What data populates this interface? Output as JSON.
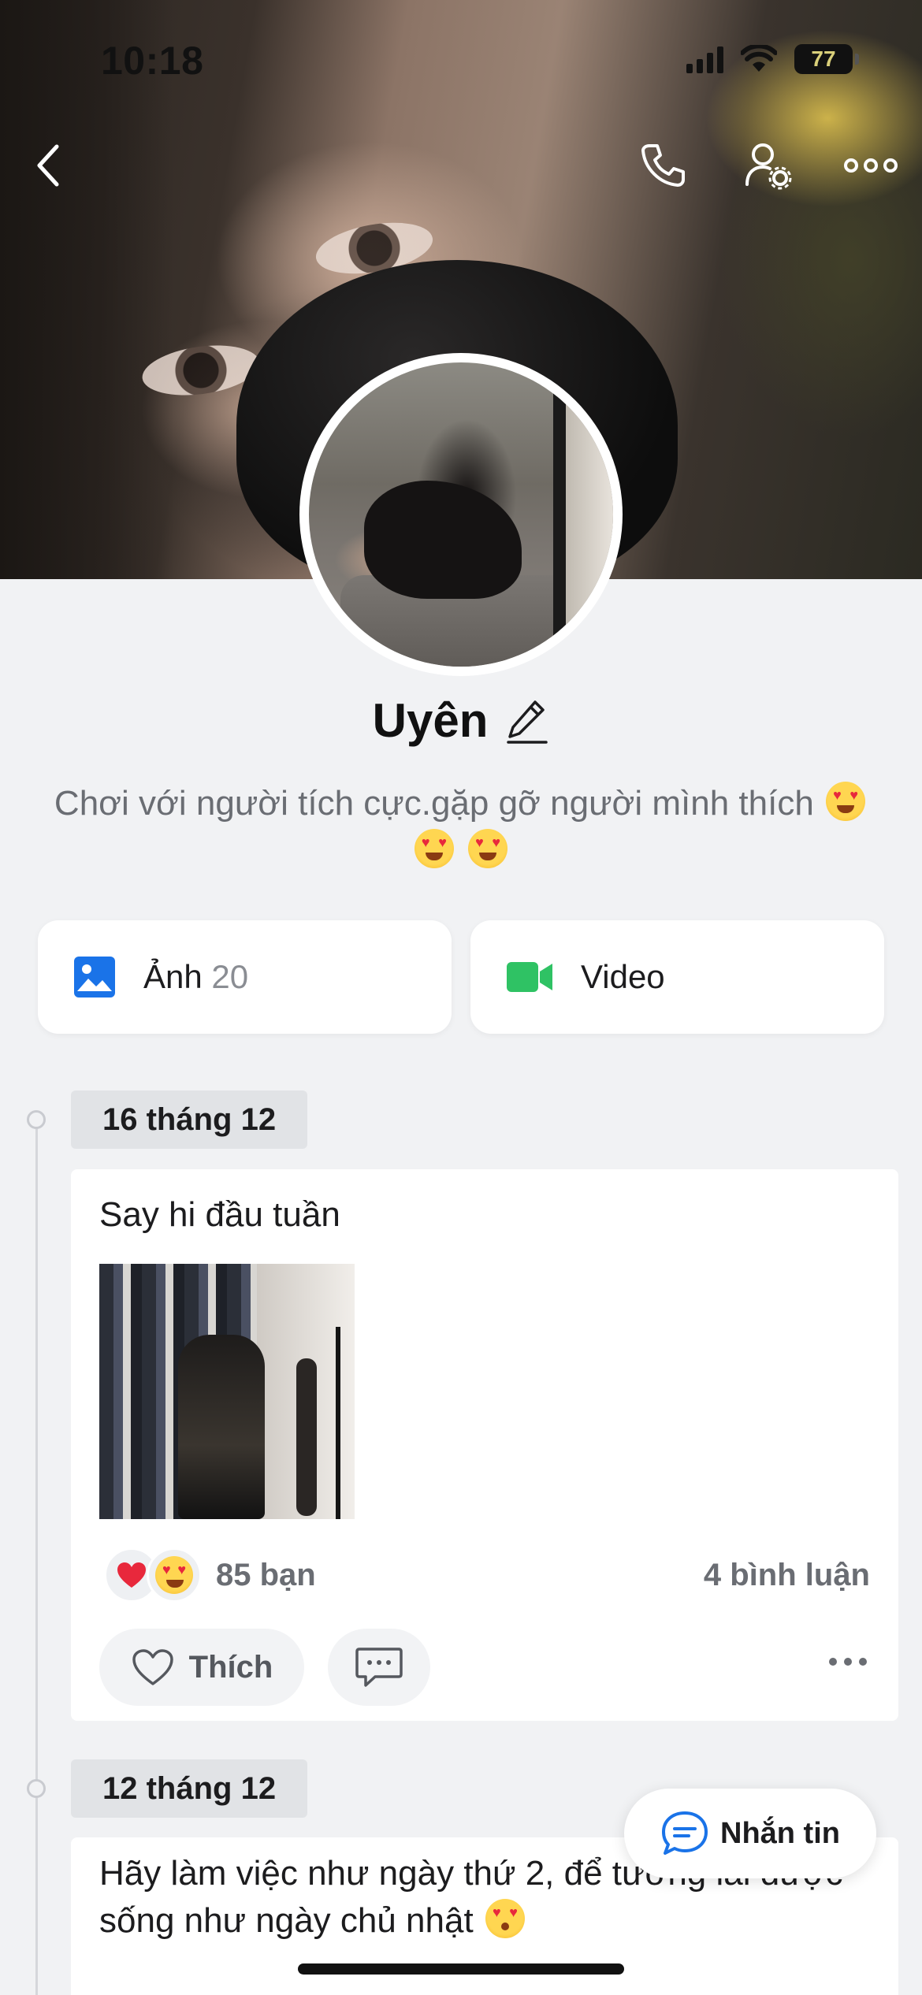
{
  "status_bar": {
    "time": "10:18",
    "battery": "77"
  },
  "profile": {
    "name": "Uyên",
    "bio_line1": "Chơi với người tích cực.gặp gỡ người mình thích",
    "bio_emojis": [
      "heart-eyes",
      "heart-eyes",
      "heart-eyes"
    ]
  },
  "media": {
    "photos_label": "Ảnh",
    "photos_count": "20",
    "video_label": "Video"
  },
  "posts": [
    {
      "date": "16 tháng 12",
      "text": "Say hi đầu tuần",
      "reactions": [
        "heart",
        "heart-eyes"
      ],
      "friends_reacted": "85 bạn",
      "comments": "4 bình luận",
      "like_label": "Thích"
    },
    {
      "date": "12 tháng 12",
      "text": "Hãy làm việc như ngày thứ 2, để tương lai được sống như ngày chủ nhật"
    }
  ],
  "message_button": {
    "label": "Nhắn tin"
  },
  "colors": {
    "accent_blue": "#1a73e8",
    "video_green": "#2fc264",
    "background": "#f1f2f4"
  },
  "icons": [
    "back-icon",
    "phone-icon",
    "user-settings-icon",
    "more-icon",
    "edit-icon",
    "photo-icon",
    "video-icon",
    "heart-outline-icon",
    "comment-icon",
    "chat-bubble-icon"
  ]
}
